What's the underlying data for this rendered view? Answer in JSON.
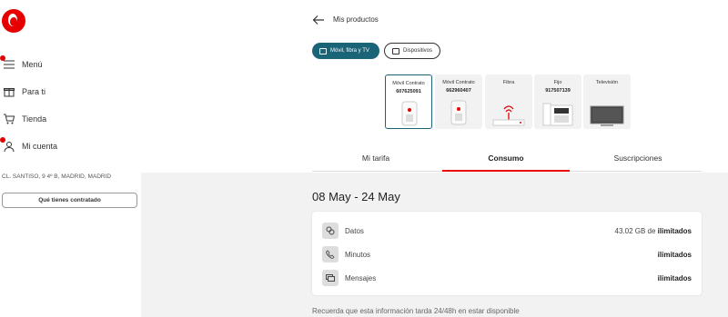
{
  "sidebar": {
    "items": [
      {
        "label": "Menú",
        "icon": "menu-icon"
      },
      {
        "label": "Para ti",
        "icon": "gift-icon"
      },
      {
        "label": "Tienda",
        "icon": "cart-icon"
      },
      {
        "label": "Mi cuenta",
        "icon": "user-icon"
      }
    ],
    "address": "CL. SANTISO, 9 4º B, MADRID, MADRID",
    "contract_button": "Qué tienes contratado"
  },
  "header": {
    "title": "Mis productos"
  },
  "filters": {
    "active": "Móvil, fibra y TV",
    "inactive": "Dispositivos"
  },
  "devices": [
    {
      "label": "Móvil Contrato",
      "number": "607625091",
      "type": "phone",
      "active": true
    },
    {
      "label": "Móvil Contrato",
      "number": "662960407",
      "type": "phone",
      "active": false
    },
    {
      "label": "Fibra",
      "number": "",
      "type": "router",
      "active": false
    },
    {
      "label": "Fijo",
      "number": "917507139",
      "type": "landline",
      "active": false
    },
    {
      "label": "Televisión",
      "number": "",
      "type": "tv",
      "active": false
    }
  ],
  "tabs": [
    "Mi tarifa",
    "Consumo",
    "Suscripciones"
  ],
  "active_tab": "Consumo",
  "usage": {
    "period": "08 May - 24 May",
    "rows": [
      {
        "label": "Datos",
        "value_prefix": "43.02 GB de ",
        "value_bold": "ilimitados",
        "icon": "data-icon"
      },
      {
        "label": "Minutos",
        "value_prefix": "",
        "value_bold": "ilimitados",
        "icon": "phone-call-icon"
      },
      {
        "label": "Mensajes",
        "value_prefix": "",
        "value_bold": "ilimitados",
        "icon": "message-icon"
      }
    ],
    "note": "Recuerda que esta información tarda 24/48h en estar disponible"
  },
  "colors": {
    "brand_red": "#e60000",
    "teal": "#1a6478"
  }
}
